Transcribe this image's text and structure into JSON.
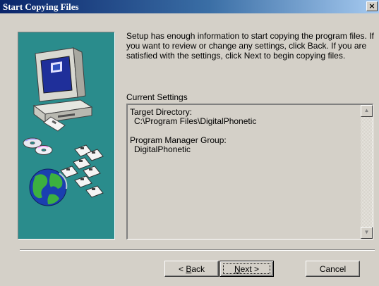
{
  "window": {
    "title": "Start Copying Files",
    "close_glyph": "×"
  },
  "intro_text": "Setup has enough information to start copying the program files. If you want to review or change any settings, click Back. If you are satisfied with the settings, click Next to begin copying files.",
  "settings": {
    "label": "Current Settings",
    "target_directory_label": "Target Directory:",
    "target_directory_value": "C:\\Program Files\\DigitalPhonetic",
    "program_group_label": "Program Manager Group:",
    "program_group_value": "DigitalPhonetic"
  },
  "buttons": {
    "back_prefix": "< ",
    "back_mnemonic": "B",
    "back_rest": "ack",
    "next_mnemonic": "N",
    "next_rest": "ext >",
    "cancel": "Cancel"
  },
  "icons": {
    "scroll_up": "▲",
    "scroll_down": "▼"
  },
  "colors": {
    "panel_teal": "#2a8c8c",
    "title_blue": "#0a246a",
    "dialog_gray": "#d4d0c8"
  }
}
